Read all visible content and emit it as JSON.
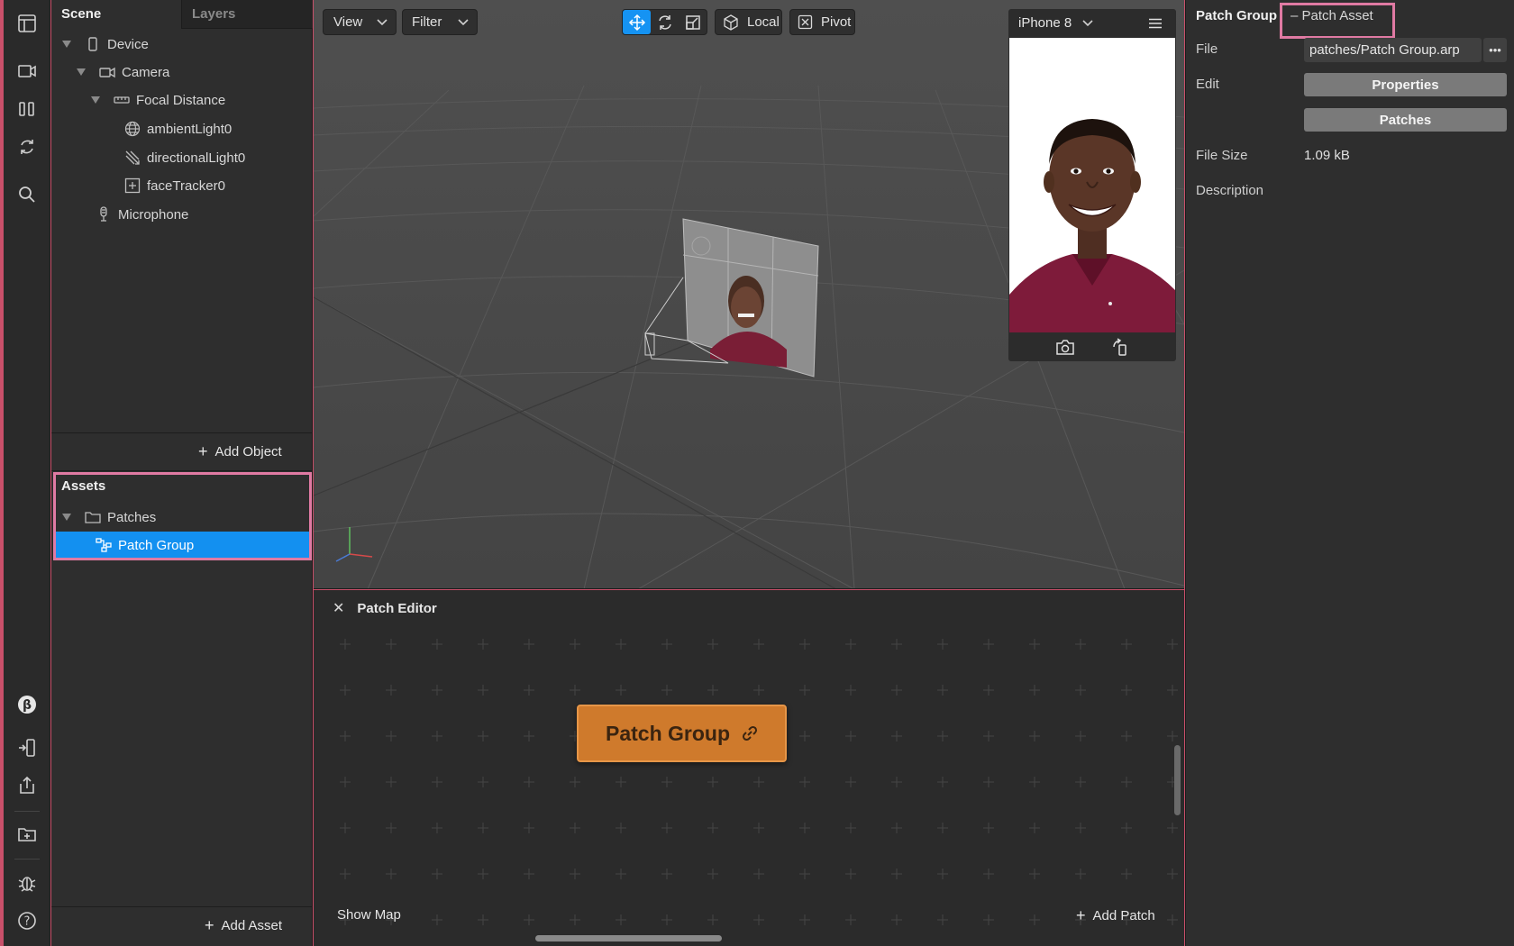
{
  "colors": {
    "selection": "#1390f0",
    "highlight_box": "#e07aa3",
    "patch_node": "#cf7a2c",
    "panel": "#2e2e2e",
    "viewport": "#4b4b4b"
  },
  "left_rail": {
    "icons": [
      "layout-icon",
      "camera-icon",
      "columns-icon",
      "refresh-icon",
      "search-icon",
      "beta-icon",
      "device-link-icon",
      "share-icon",
      "add-folder-icon",
      "bug-icon",
      "help-icon"
    ]
  },
  "scene": {
    "tabs": [
      {
        "label": "Scene",
        "active": true
      },
      {
        "label": "Layers",
        "active": false
      }
    ],
    "tree": [
      {
        "label": "Device",
        "icon": "phone-icon",
        "level": 0,
        "expanded": true
      },
      {
        "label": "Camera",
        "icon": "camera-icon",
        "level": 1,
        "expanded": true
      },
      {
        "label": "Focal Distance",
        "icon": "ruler-icon",
        "level": 2,
        "expanded": true
      },
      {
        "label": "ambientLight0",
        "icon": "globe-icon",
        "level": 3
      },
      {
        "label": "directionalLight0",
        "icon": "directional-light-icon",
        "level": 3
      },
      {
        "label": "faceTracker0",
        "icon": "face-tracker-icon",
        "level": 3
      },
      {
        "label": "Microphone",
        "icon": "microphone-icon",
        "level": 1
      }
    ],
    "add_object": "Add Object"
  },
  "assets": {
    "title": "Assets",
    "folder": "Patches",
    "selected_item": "Patch Group",
    "add_asset": "Add Asset"
  },
  "viewport": {
    "view_label": "View",
    "filter_label": "Filter",
    "tools": [
      "move-icon",
      "rotate-icon",
      "scale-icon"
    ],
    "active_tool": "move-icon",
    "local_label": "Local",
    "pivot_label": "Pivot",
    "device": "iPhone 8"
  },
  "patch_editor": {
    "title": "Patch Editor",
    "node_label": "Patch Group",
    "show_map": "Show Map",
    "add_patch": "Add Patch"
  },
  "inspector": {
    "title": "Patch Group",
    "subtitle": "– Patch Asset",
    "file_label": "File",
    "file_value": "patches/Patch Group.arp",
    "edit_label": "Edit",
    "properties_button": "Properties",
    "patches_button": "Patches",
    "file_size_label": "File Size",
    "file_size_value": "1.09 kB",
    "description_label": "Description"
  }
}
